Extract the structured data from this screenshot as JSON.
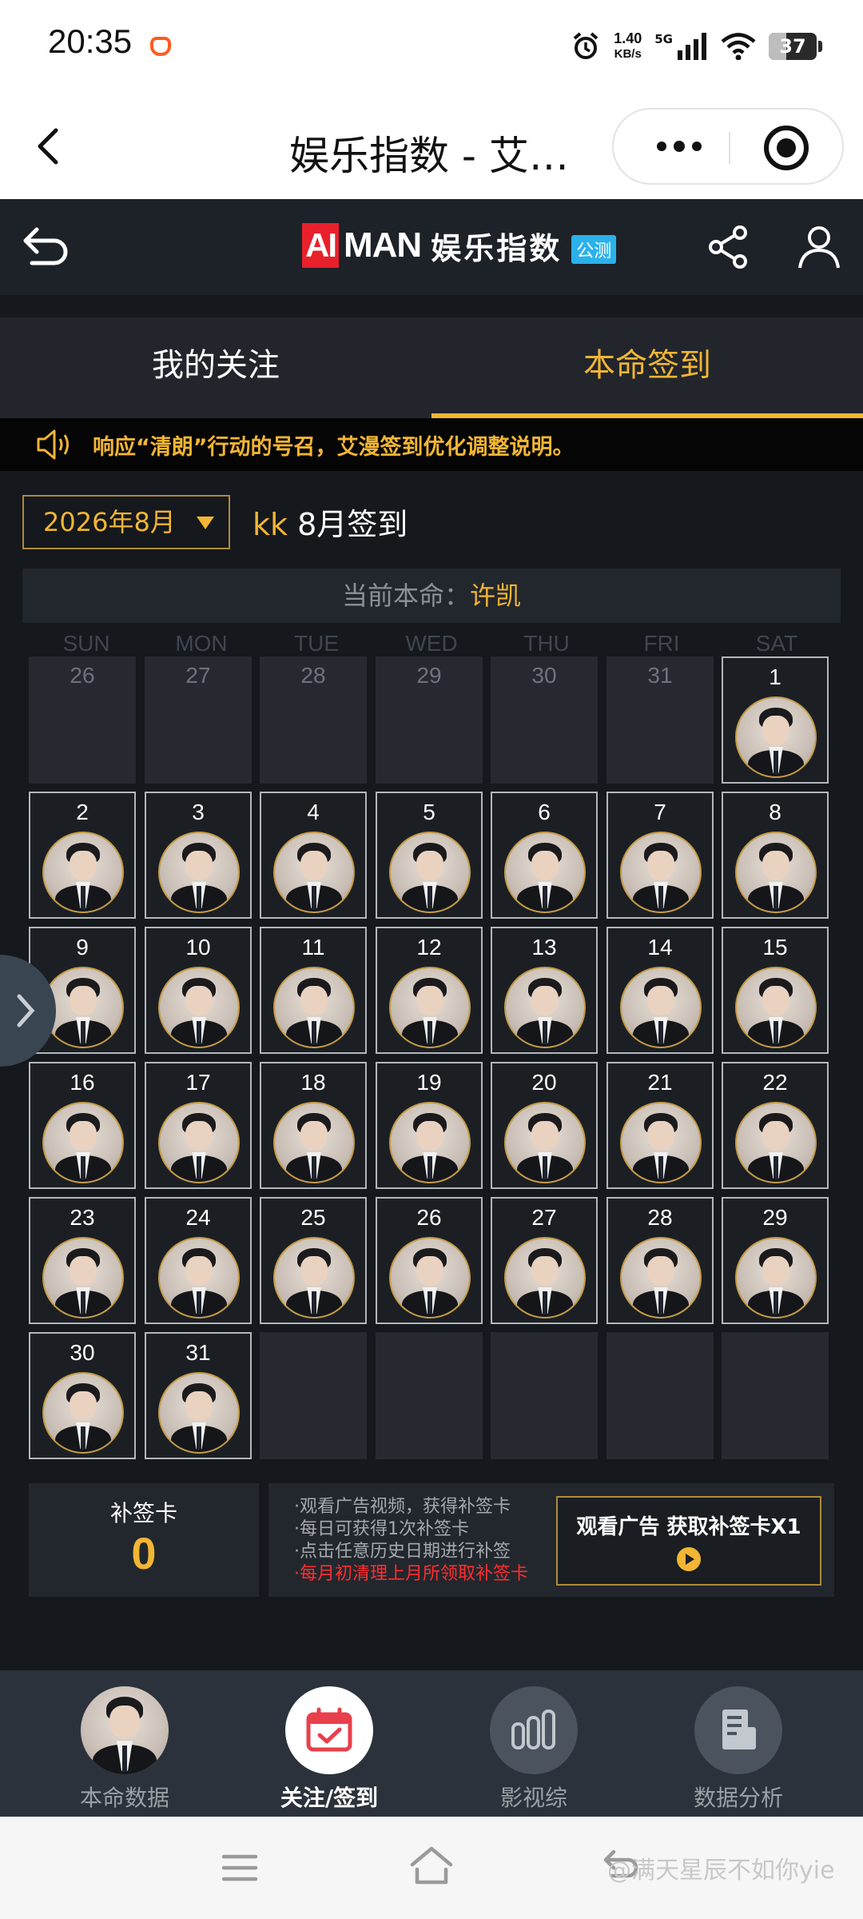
{
  "status_bar": {
    "time": "20:35",
    "net_speed_value": "1.40",
    "net_speed_unit": "KB/s",
    "network": "5G",
    "battery": "37",
    "icons": [
      "alarm-icon",
      "signal-icon",
      "wifi-icon",
      "battery-icon"
    ]
  },
  "title_bar": {
    "title": "娱乐指数 - 艾…",
    "icons": [
      "back-chevron-icon",
      "more-icon",
      "close-target-icon"
    ]
  },
  "app_header": {
    "brand_ai": "AI",
    "brand_man": "MAN",
    "brand_cn": "娱乐指数",
    "badge": "公测",
    "icons": [
      "return-icon",
      "share-icon",
      "user-icon"
    ]
  },
  "tabs": [
    {
      "label": "我的关注",
      "active": false
    },
    {
      "label": "本命签到",
      "active": true
    }
  ],
  "notice": {
    "text": "响应“清朗”行动的号召，艾漫签到优化调整说明。",
    "icon": "speaker-icon"
  },
  "calendar_header": {
    "month_select": "2026年8月",
    "user": "kk",
    "heading_suffix": " 8月签到"
  },
  "current_idol": {
    "label": "当前本命：",
    "name": "许凯"
  },
  "weekdays": [
    "SUN",
    "MON",
    "TUE",
    "WED",
    "THU",
    "FRI",
    "SAT"
  ],
  "calendar": {
    "prev_month_days": [
      "26",
      "27",
      "28",
      "29",
      "30",
      "31"
    ],
    "days_in_month": 31,
    "signed_days": "1-31",
    "trailing_blank_cells": 5
  },
  "supplement": {
    "label": "补签卡",
    "count": "0",
    "tips": [
      "·观看广告视频，获得补签卡",
      "·每日可获得1次补签卡",
      "·点击任意历史日期进行补签"
    ],
    "warning": "·每月初清理上月所领取补签卡",
    "ad_button": "观看广告 获取补签卡X1"
  },
  "bottom_nav": [
    {
      "label": "本命数据",
      "icon": "idol-avatar-icon",
      "active": false
    },
    {
      "label": "关注/签到",
      "icon": "calendar-checkin-icon",
      "active": true
    },
    {
      "label": "影视综",
      "icon": "bar-chart-icon",
      "active": false
    },
    {
      "label": "数据分析",
      "icon": "report-icon",
      "active": false
    }
  ],
  "watermark": "@满天星辰不如你yie",
  "colors": {
    "accent": "#f2b534",
    "background": "#15181d",
    "brand_red": "#e8202c",
    "badge_blue": "#2bb1ea",
    "warning_red": "#ff2d2d"
  }
}
